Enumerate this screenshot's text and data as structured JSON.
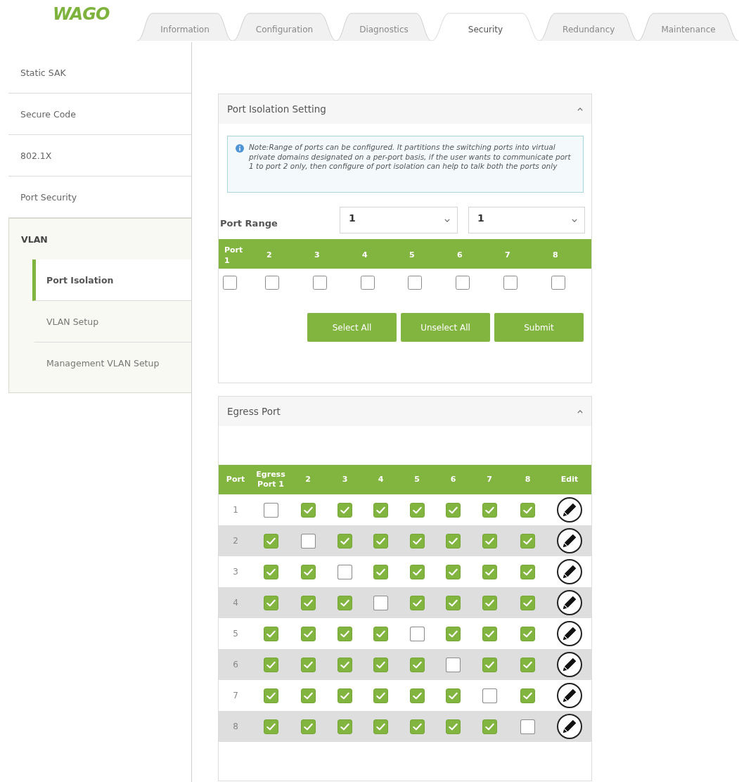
{
  "logo": "WAGO",
  "tabs": [
    {
      "label": "Information",
      "selected": false
    },
    {
      "label": "Configuration",
      "selected": false
    },
    {
      "label": "Diagnostics",
      "selected": false
    },
    {
      "label": "Security",
      "selected": true
    },
    {
      "label": "Redundancy",
      "selected": false
    },
    {
      "label": "Maintenance",
      "selected": false
    }
  ],
  "sidebar": {
    "items": [
      {
        "label": "Static SAK",
        "selected": false
      },
      {
        "label": "Secure Code",
        "selected": false
      },
      {
        "label": "802.1X",
        "selected": false
      },
      {
        "label": "Port Security",
        "selected": false
      },
      {
        "label": "VLAN",
        "selected": false,
        "children": [
          {
            "label": "Port Isolation",
            "selected": true
          },
          {
            "label": "VLAN Setup",
            "selected": false
          },
          {
            "label": "Management VLAN Setup",
            "selected": false
          }
        ]
      }
    ]
  },
  "port_isolation": {
    "title": "Port Isolation Setting",
    "note": "Note:Range of ports can be configured. It partitions the switching ports into virtual private domains designated on a per-port basis, if the user wants to communicate port 1 to port 2 only, then configure of port isolation can help to talk both the ports only",
    "port_range": {
      "label": "Port Range",
      "from": "1",
      "to": "1"
    },
    "ports": [
      {
        "label": "Port 1",
        "checked": false
      },
      {
        "label": "2",
        "checked": false
      },
      {
        "label": "3",
        "checked": false
      },
      {
        "label": "4",
        "checked": false
      },
      {
        "label": "5",
        "checked": false
      },
      {
        "label": "6",
        "checked": false
      },
      {
        "label": "7",
        "checked": false
      },
      {
        "label": "8",
        "checked": false
      }
    ],
    "buttons": [
      "Select All",
      "Unselect All",
      "Submit"
    ]
  },
  "egress_port": {
    "title": "Egress Port",
    "columns": [
      "Port",
      "Egress Port 1",
      "2",
      "3",
      "4",
      "5",
      "6",
      "7",
      "8",
      "Edit"
    ],
    "rows": [
      {
        "port": "1",
        "checked": [
          false,
          true,
          true,
          true,
          true,
          true,
          true,
          true
        ]
      },
      {
        "port": "2",
        "checked": [
          true,
          false,
          true,
          true,
          true,
          true,
          true,
          true
        ]
      },
      {
        "port": "3",
        "checked": [
          true,
          true,
          false,
          true,
          true,
          true,
          true,
          true
        ]
      },
      {
        "port": "4",
        "checked": [
          true,
          true,
          true,
          false,
          true,
          true,
          true,
          true
        ]
      },
      {
        "port": "5",
        "checked": [
          true,
          true,
          true,
          true,
          false,
          true,
          true,
          true
        ]
      },
      {
        "port": "6",
        "checked": [
          true,
          true,
          true,
          true,
          true,
          false,
          true,
          true
        ]
      },
      {
        "port": "7",
        "checked": [
          true,
          true,
          true,
          true,
          true,
          true,
          false,
          true
        ]
      },
      {
        "port": "8",
        "checked": [
          true,
          true,
          true,
          true,
          true,
          true,
          true,
          false
        ]
      }
    ]
  }
}
